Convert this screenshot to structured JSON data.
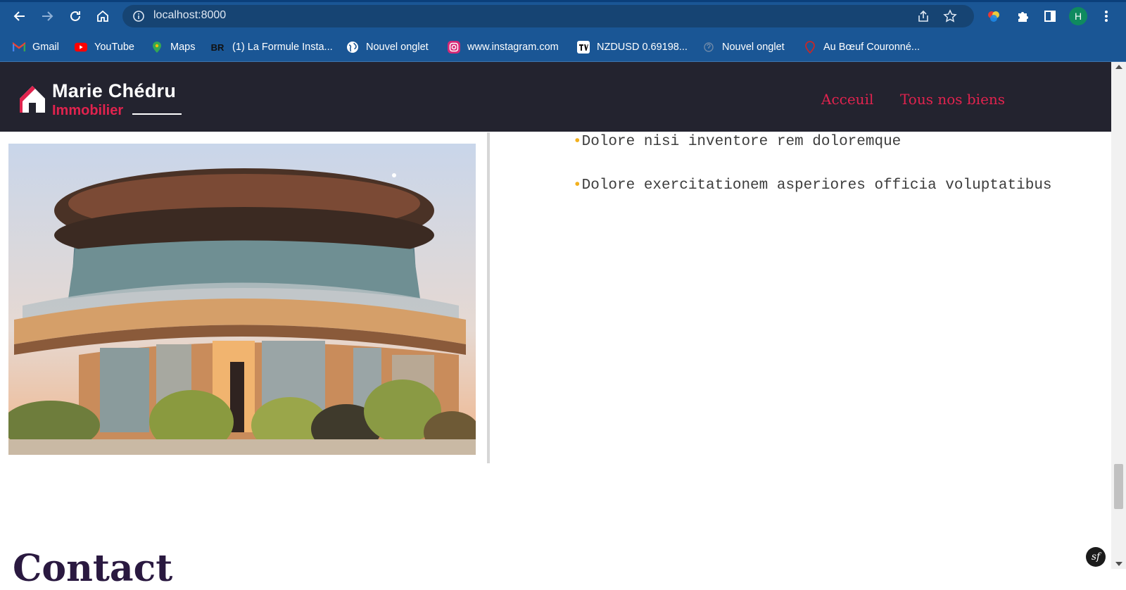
{
  "browser": {
    "url": "localhost:8000",
    "profile_initial": "H",
    "bookmarks": [
      {
        "label": "Gmail",
        "icon": "gmail-icon"
      },
      {
        "label": "YouTube",
        "icon": "youtube-icon"
      },
      {
        "label": "Maps",
        "icon": "maps-icon"
      },
      {
        "label": "(1) La Formule Insta...",
        "icon": "br-icon",
        "icon_text": "BR"
      },
      {
        "label": "Nouvel onglet",
        "icon": "globe-icon"
      },
      {
        "label": "www.instagram.com",
        "icon": "instagram-icon"
      },
      {
        "label": "NZDUSD 0.69198...",
        "icon": "tradingview-icon"
      },
      {
        "label": "Nouvel onglet",
        "icon": "page-icon"
      },
      {
        "label": "Au Bœuf Couronné...",
        "icon": "location-icon"
      }
    ]
  },
  "site": {
    "logo_name": "Marie Chédru",
    "logo_sub": "Immobilier",
    "nav": [
      "Acceuil",
      "Tous nos biens"
    ]
  },
  "property": {
    "features": [
      "Dolore nisi inventore rem doloremque",
      "Dolore exercitationem asperiores officia voluptatibus"
    ],
    "bullet_char": "•",
    "photo_icon": "round-modern-house-photo"
  },
  "contact": {
    "title": "Contact"
  },
  "debug": {
    "symfony_badge": "sf"
  },
  "colors": {
    "browser_chrome": "#1a5695",
    "header_bg": "#23232f",
    "accent": "#e0234e",
    "bullet": "#f2b01e"
  }
}
